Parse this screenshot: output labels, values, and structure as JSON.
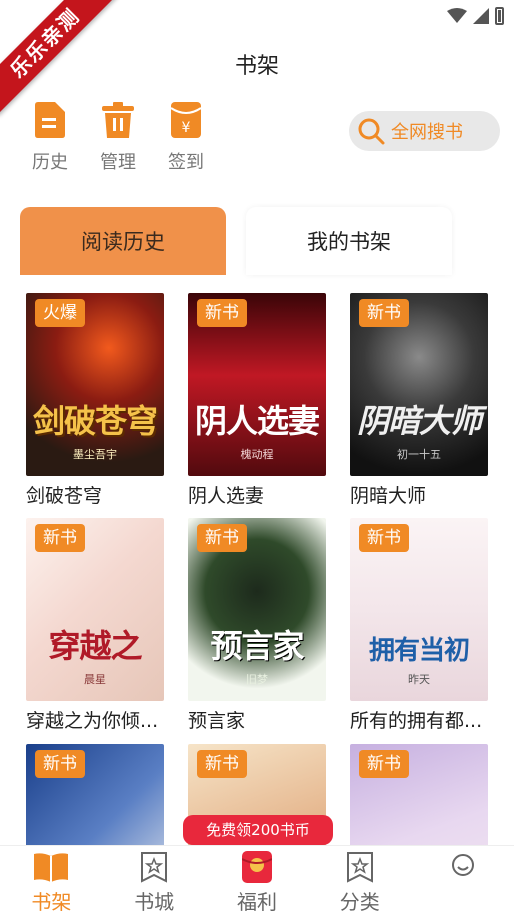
{
  "ribbon": {
    "text": "乐乐亲测"
  },
  "header": {
    "title": "书架"
  },
  "quick_actions": [
    {
      "label": "历史",
      "icon": "document-icon"
    },
    {
      "label": "管理",
      "icon": "trash-icon"
    },
    {
      "label": "签到",
      "icon": "red-envelope-icon"
    }
  ],
  "search": {
    "label": "全网搜书",
    "icon": "search-icon"
  },
  "segments": {
    "history": "阅读历史",
    "shelf": "我的书架"
  },
  "books": [
    {
      "title": "剑破苍穹",
      "badge": "火爆",
      "cover_text": "剑破苍穹",
      "cover_author": "墨尘吾宇"
    },
    {
      "title": "阴人选妻",
      "badge": "新书",
      "cover_text": "阴人选妻",
      "cover_author": "槐动程"
    },
    {
      "title": "阴暗大师",
      "badge": "新书",
      "cover_text": "阴暗大师",
      "cover_author": "初一十五"
    },
    {
      "title": "穿越之为你倾...",
      "badge": "新书",
      "cover_text": "穿越之",
      "cover_author": "晨星"
    },
    {
      "title": "预言家",
      "badge": "新书",
      "cover_text": "预言家",
      "cover_author": "旧梦"
    },
    {
      "title": "所有的拥有都...",
      "badge": "新书",
      "cover_text": "拥有当初",
      "cover_author": "昨天"
    },
    {
      "title": "",
      "badge": "新书",
      "cover_text": "",
      "cover_author": ""
    },
    {
      "title": "",
      "badge": "新书",
      "cover_text": "",
      "cover_author": ""
    },
    {
      "title": "",
      "badge": "新书",
      "cover_text": "",
      "cover_author": ""
    }
  ],
  "promo": {
    "label": "免费领200书币"
  },
  "tabbar": [
    {
      "label": "书架",
      "icon": "book-icon",
      "active": true
    },
    {
      "label": "书城",
      "icon": "store-icon",
      "active": false
    },
    {
      "label": "福利",
      "icon": "gift-icon",
      "active": false
    },
    {
      "label": "分类",
      "icon": "category-icon",
      "active": false
    },
    {
      "label": "",
      "icon": "profile-icon",
      "active": false
    }
  ],
  "colors": {
    "accent": "#f08a25",
    "ribbon": "#c4151c",
    "promo": "#e8283c",
    "segment_active": "#f0914a"
  }
}
